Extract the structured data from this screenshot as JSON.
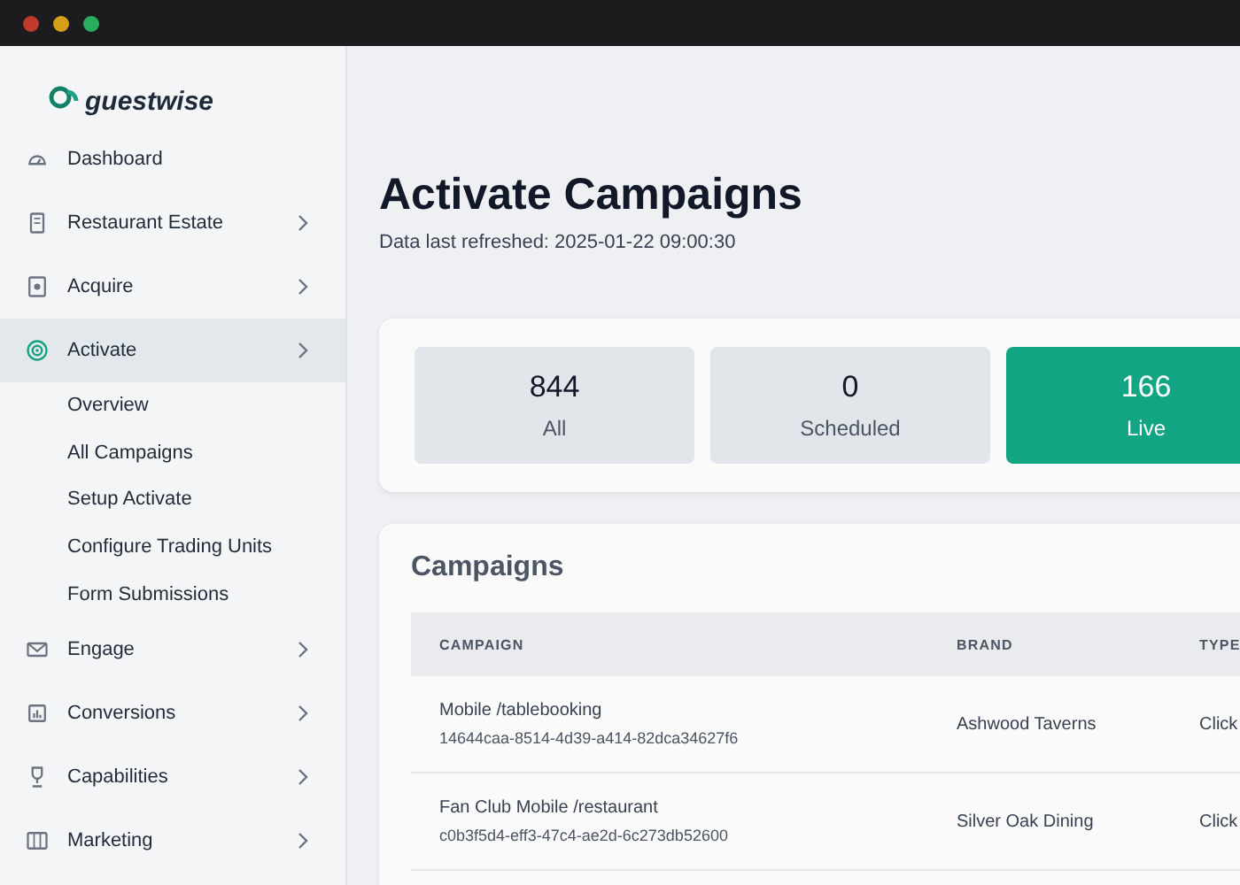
{
  "sidebar": {
    "logo": "guestwise",
    "items": [
      {
        "label": "Dashboard",
        "kind": "link",
        "selected": false
      },
      {
        "label": "Restaurant Estate",
        "kind": "group",
        "selected": false
      },
      {
        "label": "Acquire",
        "kind": "group",
        "selected": false
      },
      {
        "label": "Activate",
        "kind": "group",
        "selected": true,
        "children": [
          {
            "label": "Overview"
          },
          {
            "label": "All Campaigns"
          },
          {
            "label": "Setup Activate"
          },
          {
            "label": "Configure Trading Units"
          },
          {
            "label": "Form Submissions"
          }
        ]
      },
      {
        "label": "Engage",
        "kind": "group",
        "selected": false
      },
      {
        "label": "Conversions",
        "kind": "group",
        "selected": false
      },
      {
        "label": "Capabilities",
        "kind": "group",
        "selected": false
      },
      {
        "label": "Marketing",
        "kind": "group",
        "selected": false
      }
    ]
  },
  "page": {
    "title": "Activate Campaigns",
    "subtitle": "Data last refreshed: 2025-01-22 09:00:30"
  },
  "stats": [
    {
      "count": "844",
      "label": "All",
      "selected": false
    },
    {
      "count": "0",
      "label": "Scheduled",
      "selected": false
    },
    {
      "count": "166",
      "label": "Live",
      "selected": true
    }
  ],
  "table": {
    "title": "Campaigns",
    "columns": [
      "CAMPAIGN",
      "BRAND",
      "TYPE"
    ],
    "rows": [
      {
        "name": "Mobile /tablebooking",
        "id": "14644caa-8514-4d39-a414-82dca34627f6",
        "brand": "Ashwood Taverns",
        "type": "Click"
      },
      {
        "name": "Fan Club Mobile /restaurant",
        "id": "c0b3f5d4-eff3-47c4-ae2d-6c273db52600",
        "brand": "Silver Oak Dining",
        "type": "Click"
      }
    ]
  }
}
